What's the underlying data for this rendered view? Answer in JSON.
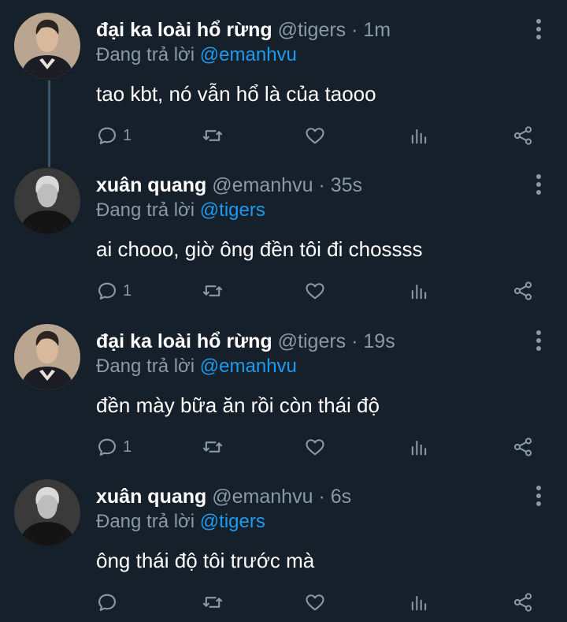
{
  "colors": {
    "background": "#15202b",
    "primary_text": "#ffffff",
    "secondary_text": "#8b98a5",
    "mention": "#1d9bf0",
    "thread_line": "#3d5466"
  },
  "replying_prefix": "Đang trả lời",
  "tweets": [
    {
      "name": "đại ka loài hổ rừng",
      "handle": "@tigers",
      "time": "· 1m",
      "replying_to": "@emanhvu",
      "text": "tao kbt, nó vẫn hổ là của taooo",
      "reply_count": "1",
      "avatar": "avatar-tigers"
    },
    {
      "name": "xuân quang",
      "handle": "@emanhvu",
      "time": "· 35s",
      "replying_to": "@tigers",
      "text": "ai chooo, giờ ông đền tôi đi chossss",
      "reply_count": "1",
      "avatar": "avatar-emanhvu"
    },
    {
      "name": "đại ka loài hổ rừng",
      "handle": "@tigers",
      "time": "· 19s",
      "replying_to": "@emanhvu",
      "text": "đền mày bữa ăn rồi còn thái độ",
      "reply_count": "1",
      "avatar": "avatar-tigers"
    },
    {
      "name": "xuân quang",
      "handle": "@emanhvu",
      "time": "· 6s",
      "replying_to": "@tigers",
      "text": "ông thái độ tôi trước mà",
      "reply_count": "",
      "avatar": "avatar-emanhvu"
    }
  ],
  "icons": {
    "reply": "reply-icon",
    "retweet": "retweet-icon",
    "like": "heart-icon",
    "views": "views-icon",
    "share": "share-icon",
    "more": "more-icon"
  }
}
